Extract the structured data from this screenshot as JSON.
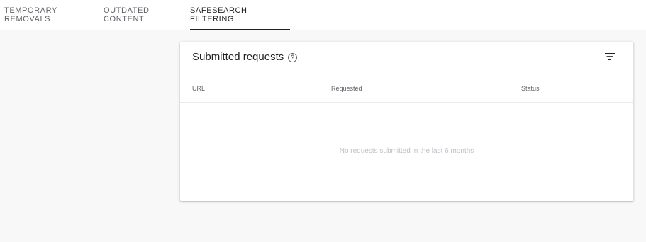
{
  "tabs": [
    {
      "label": "TEMPORARY REMOVALS"
    },
    {
      "label": "OUTDATED CONTENT"
    },
    {
      "label": "SAFESEARCH FILTERING",
      "active": true
    }
  ],
  "card": {
    "title": "Submitted requests",
    "help_icon": "help-circle-icon",
    "filter_icon": "filter-list-icon",
    "columns": [
      "URL",
      "Requested",
      "Status"
    ],
    "empty_message": "No requests submitted in the last 6 months"
  },
  "colors": {
    "active_tab": "#202124",
    "muted_text": "#5f6368",
    "empty_text": "#bdc1c6",
    "page_bg": "#f8f8f8"
  }
}
